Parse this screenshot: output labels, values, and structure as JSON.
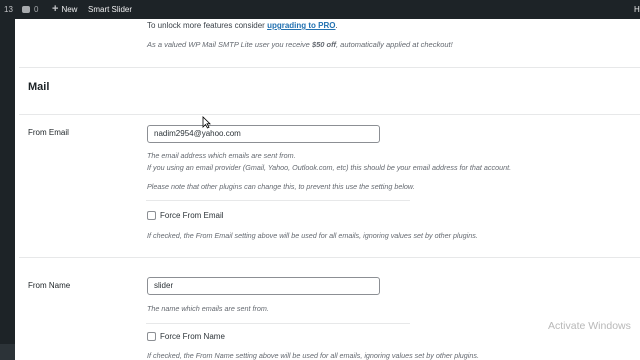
{
  "admin_bar": {
    "count": "13",
    "comments_count": "0",
    "new_label": "New",
    "smart_slider_label": "Smart Slider",
    "howdy_label": "H"
  },
  "upsell": {
    "text_prefix": "To unlock more features consider ",
    "link_text": "upgrading to PRO",
    "text_suffix": ".",
    "discount_prefix": "As a valued WP Mail SMTP Lite user you receive ",
    "discount_amount": "$50 off",
    "discount_suffix": ", automatically applied at checkout!"
  },
  "mail_section": {
    "title": "Mail",
    "from_email": {
      "label": "From Email",
      "value": "nadim2954@yahoo.com",
      "desc_1": "The email address which emails are sent from.",
      "desc_2": "If you using an email provider (Gmail, Yahoo, Outlook.com, etc) this should be your email address for that account.",
      "desc_3": "Please note that other plugins can change this, to prevent this use the setting below.",
      "force_label": "Force From Email",
      "force_checked": false,
      "force_desc": "If checked, the From Email setting above will be used for all emails, ignoring values set by other plugins."
    },
    "from_name": {
      "label": "From Name",
      "value": "slider",
      "desc_1": "The name which emails are sent from.",
      "force_label": "Force From Name",
      "force_checked": false,
      "force_desc": "If checked, the From Name setting above will be used for all emails, ignoring values set by other plugins."
    }
  },
  "watermark": "Activate Windows",
  "colors": {
    "admin_bar_bg": "#1d2327",
    "link": "#2271b1",
    "content_bg": "#ffffff"
  }
}
